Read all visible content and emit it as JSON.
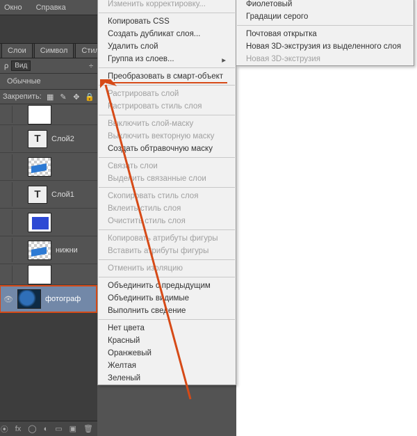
{
  "menubar": {
    "items": [
      "Окно",
      "Справка"
    ]
  },
  "panel": {
    "tabs": [
      "Слои",
      "Символ",
      "Стил"
    ],
    "view_label": "Вид",
    "blend_mode": "Обычные",
    "lock_label": "Закрепить:"
  },
  "layers": [
    {
      "label": ""
    },
    {
      "label": "Слой2",
      "type": "T"
    },
    {
      "label": ""
    },
    {
      "label": "Слой1",
      "type": "T"
    },
    {
      "label": ""
    },
    {
      "label": "нижни"
    },
    {
      "label": ""
    },
    {
      "label": "фотограф",
      "selected": true
    }
  ],
  "ctx1": [
    {
      "t": "Изменить корректировку...",
      "d": true
    },
    {
      "sep": true
    },
    {
      "t": "Копировать CSS"
    },
    {
      "t": "Создать дубликат слоя..."
    },
    {
      "t": "Удалить слой"
    },
    {
      "t": "Группа из слоев...",
      "sub": true
    },
    {
      "sep": true
    },
    {
      "t": "Преобразовать в смарт-объект",
      "hl": true
    },
    {
      "sep": true
    },
    {
      "t": "Растрировать слой",
      "d": true
    },
    {
      "t": "Растрировать стиль слоя",
      "d": true
    },
    {
      "sep": true
    },
    {
      "t": "Выключить слой-маску",
      "d": true
    },
    {
      "t": "Выключить векторную маску",
      "d": true
    },
    {
      "t": "Создать обтравочную маску"
    },
    {
      "sep": true
    },
    {
      "t": "Связать слои",
      "d": true
    },
    {
      "t": "Выделить связанные слои",
      "d": true
    },
    {
      "sep": true
    },
    {
      "t": "Скопировать стиль слоя",
      "d": true
    },
    {
      "t": "Вклеить стиль слоя",
      "d": true
    },
    {
      "t": "Очистить стиль слоя",
      "d": true
    },
    {
      "sep": true
    },
    {
      "t": "Копировать атрибуты фигуры",
      "d": true
    },
    {
      "t": "Вставить атрибуты фигуры",
      "d": true
    },
    {
      "sep": true
    },
    {
      "t": "Отменить изоляцию",
      "d": true
    },
    {
      "sep": true
    },
    {
      "t": "Объединить с предыдущим"
    },
    {
      "t": "Объединить видимые"
    },
    {
      "t": "Выполнить сведение"
    },
    {
      "sep": true
    },
    {
      "t": "Нет цвета"
    },
    {
      "t": "Красный"
    },
    {
      "t": "Оранжевый"
    },
    {
      "t": "Желтая"
    },
    {
      "t": "Зеленый"
    }
  ],
  "ctx2": [
    {
      "t": "Фиолетовый"
    },
    {
      "t": "Градации серого"
    },
    {
      "sep": true
    },
    {
      "t": "Почтовая открытка"
    },
    {
      "t": "Новая 3D-экструзия из выделенного слоя"
    },
    {
      "t": "Новая 3D-экструзия",
      "d": true
    }
  ],
  "footer_icons": [
    "link",
    "fx",
    "mask",
    "adjust",
    "folder",
    "new",
    "trash"
  ]
}
